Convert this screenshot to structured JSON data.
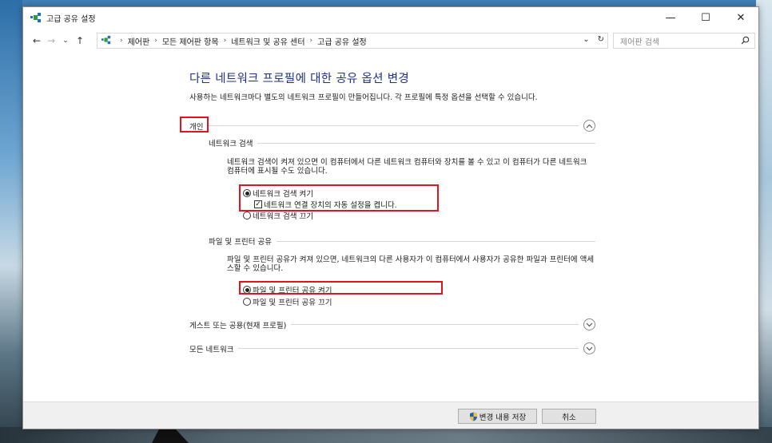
{
  "window": {
    "title": "고급 공유 설정",
    "controls": {
      "minimize": "—",
      "maximize": "☐",
      "close": "✕"
    }
  },
  "navigation": {
    "back": "←",
    "forward": "→",
    "recent": "⌄",
    "up": "↑",
    "breadcrumbs": [
      "제어판",
      "모든 제어판 항목",
      "네트워크 및 공유 센터",
      "고급 공유 설정"
    ],
    "dropdown": "⌄",
    "refresh": "↻",
    "search_placeholder": "제어판 검색"
  },
  "main": {
    "heading": "다른 네트워크 프로필에 대한 공유 옵션 변경",
    "description": "사용하는 네트워크마다 별도의 네트워크 프로필이 만들어집니다. 각 프로필에 특정 옵션을 선택할 수 있습니다.",
    "profiles": [
      {
        "label": "개인",
        "expanded": true,
        "subsections": [
          {
            "label": "네트워크 검색",
            "text": "네트워크 검색이 켜져 있으면 이 컴퓨터에서 다른 네트워크 컴퓨터와 장치를 볼 수 있고 이 컴퓨터가 다른 네트워크 컴퓨터에 표시될 수도 있습니다.",
            "options": [
              {
                "label": "네트워크 검색 켜기",
                "selected": true
              },
              {
                "label": "네트워크 검색 끄기",
                "selected": false
              }
            ],
            "checkbox": {
              "label": "네트워크 연결 장치의 자동 설정을 켭니다.",
              "checked": true
            }
          },
          {
            "label": "파일 및 프린터 공유",
            "text": "파일 및 프린터 공유가 켜져 있으면, 네트워크의 다른 사용자가 이 컴퓨터에서 사용자가 공유한 파일과 프린터에 액세스할 수 있습니다.",
            "options": [
              {
                "label": "파일 및 프린터 공유 켜기",
                "selected": true
              },
              {
                "label": "파일 및 프린터 공유 끄기",
                "selected": false
              }
            ]
          }
        ]
      },
      {
        "label": "게스트 또는 공용(현재 프로필)",
        "expanded": false
      },
      {
        "label": "모든 네트워크",
        "expanded": false
      }
    ]
  },
  "footer": {
    "save_label": "변경 내용 저장",
    "cancel_label": "취소"
  },
  "colors": {
    "heading": "#1e3287",
    "highlight": "#e0141e",
    "footer_bg": "#f0f0f0"
  }
}
